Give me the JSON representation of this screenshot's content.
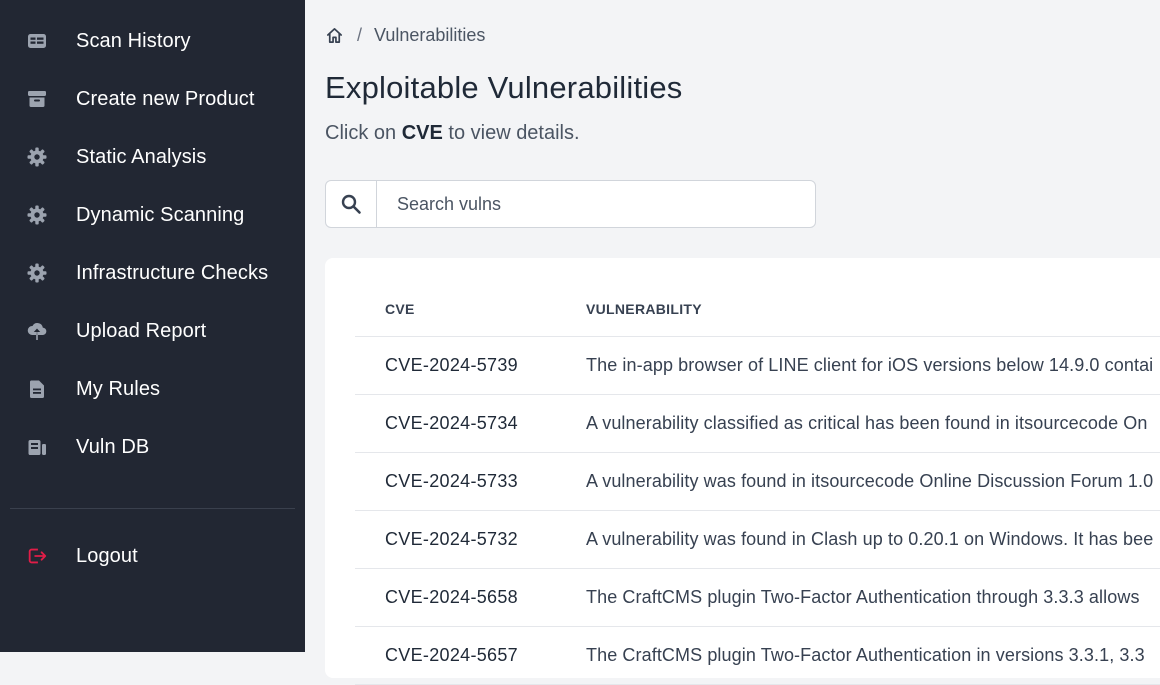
{
  "sidebar": {
    "items": [
      {
        "label": "Scan History",
        "icon": "table-icon"
      },
      {
        "label": "Create new Product",
        "icon": "archive-icon"
      },
      {
        "label": "Static Analysis",
        "icon": "gear-icon"
      },
      {
        "label": "Dynamic Scanning",
        "icon": "gear-icon"
      },
      {
        "label": "Infrastructure Checks",
        "icon": "gear-icon"
      },
      {
        "label": "Upload Report",
        "icon": "cloud-upload-icon"
      },
      {
        "label": "My Rules",
        "icon": "document-icon"
      },
      {
        "label": "Vuln DB",
        "icon": "database-icon"
      }
    ],
    "logout": {
      "label": "Logout",
      "icon": "logout-icon"
    }
  },
  "breadcrumb": {
    "home_icon": "home-icon",
    "separator": "/",
    "current": "Vulnerabilities"
  },
  "page": {
    "title": "Exploitable Vulnerabilities",
    "subtitle_prefix": "Click on ",
    "subtitle_bold": "CVE",
    "subtitle_suffix": " to view details."
  },
  "search": {
    "icon": "search-icon",
    "placeholder": "Search vulns",
    "value": ""
  },
  "table": {
    "headers": {
      "cve": "CVE",
      "vulnerability": "VULNERABILITY"
    },
    "rows": [
      {
        "cve": "CVE-2024-5739",
        "description": "The in-app browser of LINE client for iOS versions below 14.9.0 contai"
      },
      {
        "cve": "CVE-2024-5734",
        "description": "A vulnerability classified as critical has been found in itsourcecode On"
      },
      {
        "cve": "CVE-2024-5733",
        "description": "A vulnerability was found in itsourcecode Online Discussion Forum 1.0"
      },
      {
        "cve": "CVE-2024-5732",
        "description": "A vulnerability was found in Clash up to 0.20.1 on Windows. It has bee"
      },
      {
        "cve": "CVE-2024-5658",
        "description": "The CraftCMS plugin Two-Factor Authentication through 3.3.3 allows"
      },
      {
        "cve": "CVE-2024-5657",
        "description": "The CraftCMS plugin Two-Factor Authentication in versions 3.3.1, 3.3"
      }
    ]
  },
  "colors": {
    "sidebar_bg": "#222733",
    "sidebar_text": "#ffffff",
    "sidebar_icon": "#9ca3af",
    "logout_icon": "#e11d48",
    "page_bg": "#f3f4f6"
  }
}
